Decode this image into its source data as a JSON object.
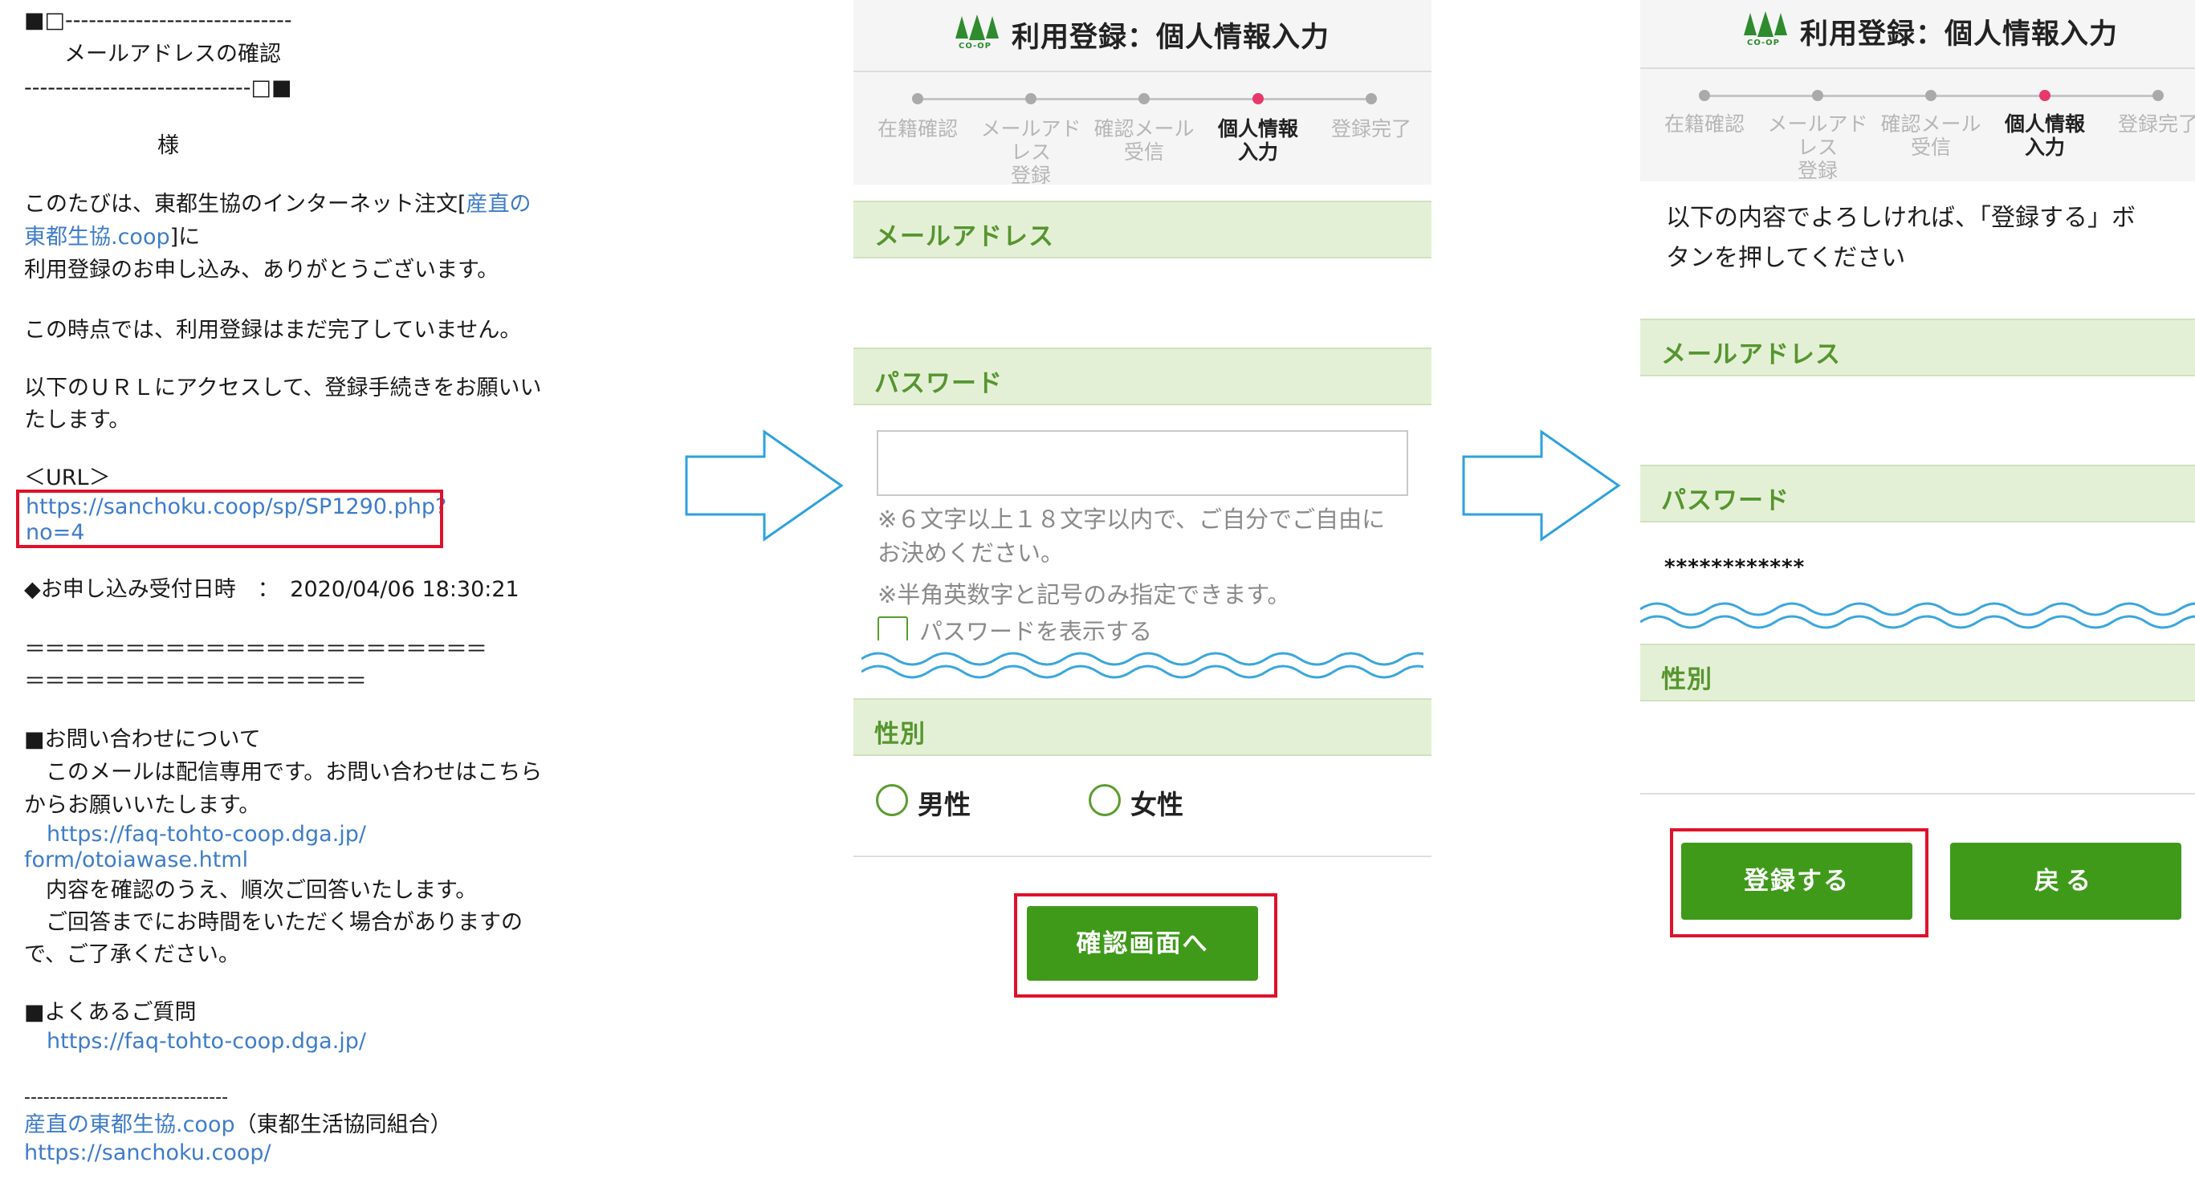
{
  "email": {
    "header_line_1": "■□-----------------------------",
    "subject": "メールアドレスの確認",
    "header_line_2": "-----------------------------□■",
    "salutation": "様",
    "intro_prefix": "このたびは、東都生協のインターネット注文[",
    "shop_link_part1": "産直の",
    "shop_link_part2": "東都生協.coop",
    "intro_suffix": "]に",
    "intro_line_2": "利用登録のお申し込み、ありがとうございます。",
    "not_complete": "この時点では、利用登録はまだ完了していません。",
    "instruction_line_1": "以下のＵＲＬにアクセスして、登録手続きをお願いい",
    "instruction_line_2": "たします。",
    "url_label": "＜URL＞",
    "url_line_1": "https://sanchoku.coop/sp/SP1290.php?",
    "url_line_2": "no=4",
    "received_label": "◆お申し込み受付日時　：　2020/04/06 18:30:21",
    "separator_1": "＝＝＝＝＝＝＝＝＝＝＝＝＝＝＝＝＝＝＝＝＝＝＝",
    "separator_2": "＝＝＝＝＝＝＝＝＝＝＝＝＝＝＝＝＝",
    "inquiry_heading": "■お問い合わせについて",
    "inquiry_line_1": "　このメールは配信専用です。お問い合わせはこちら",
    "inquiry_line_2": "からお願いいたします。",
    "inquiry_url_1": "https://faq-tohto-coop.dga.jp/",
    "inquiry_url_2": "form/otoiawase.html",
    "inquiry_line_3": "　内容を確認のうえ、順次ご回答いたします。",
    "inquiry_line_4": "　ご回答までにお時間をいただく場合がありますの",
    "inquiry_line_5": "で、ご了承ください。",
    "faq_heading": "■よくあるご質問",
    "faq_url": "https://faq-tohto-coop.dga.jp/",
    "footer_separator": "--------------------------------",
    "footer_link": "産直の東都生協.coop",
    "footer_org": "（東都生活協同組合）",
    "footer_url": "https://sanchoku.coop/"
  },
  "panel": {
    "title": "利用登録：個人情報入力",
    "logo_text": "CO-OP",
    "steps": [
      {
        "line1": "在籍確認",
        "line2": ""
      },
      {
        "line1": "メールアドレス",
        "line2": "登録"
      },
      {
        "line1": "確認メール",
        "line2": "受信"
      },
      {
        "line1": "個人情報",
        "line2": "入力"
      },
      {
        "line1": "登録完了",
        "line2": ""
      }
    ],
    "active_step": 4,
    "email_section": "メールアドレス",
    "password_section": "パスワード",
    "gender_section": "性別",
    "password_placeholder": "",
    "note_1_line_1": "※６文字以上１８文字以内で、ご自分でご自由に",
    "note_1_line_2": "お決めください。",
    "note_2": "※半角英数字と記号のみ指定できます。",
    "show_password": "パスワードを表示する",
    "male": "男性",
    "female": "女性",
    "confirm_button": "確認画面へ"
  },
  "confirm_panel": {
    "message_line_1": "以下の内容でよろしければ、「登録する」ボ",
    "message_line_2": "タンを押してください",
    "masked_password": "************",
    "register_button": "登録する",
    "back_button": "戻る"
  },
  "colors": {
    "accent_green": "#3f9a1a",
    "section_bg": "#e4f0d6",
    "section_text": "#56952f",
    "active_step": "#e8386b",
    "highlight_red": "#e0112b",
    "arrow_blue": "#2ea1dd",
    "wave_blue": "#3aa6dd",
    "link_blue": "#3e7cc9"
  }
}
